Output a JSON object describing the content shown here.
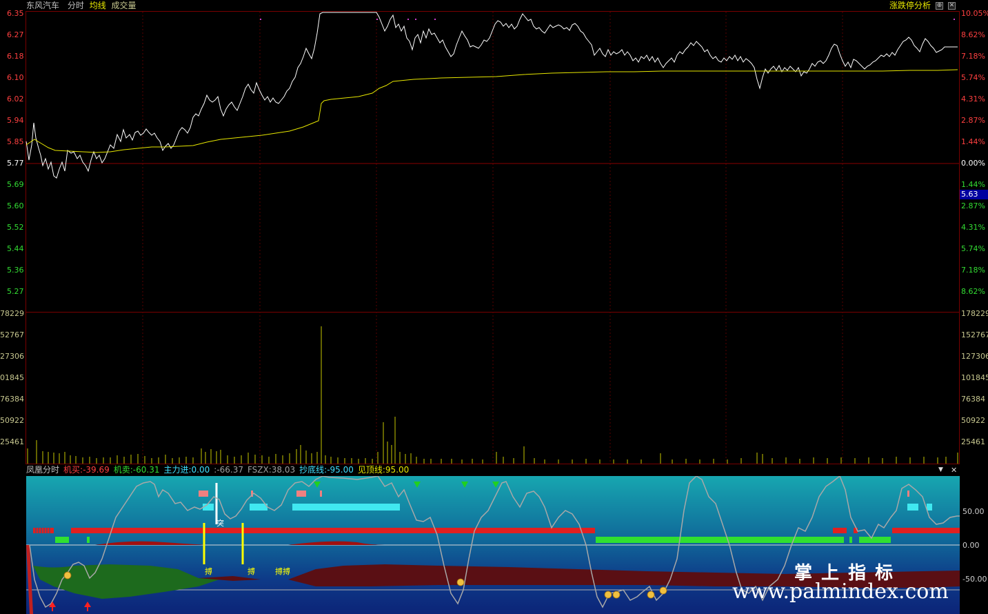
{
  "header": {
    "stock_name": "东风汽车",
    "tab_time": "分时",
    "tab_avg": "均线",
    "tab_volume": "成交量",
    "right_link": "涨跌停分析"
  },
  "price_axis": {
    "left": [
      "6.35",
      "6.27",
      "6.18",
      "6.10",
      "6.02",
      "5.94",
      "5.85",
      "5.77",
      "5.69",
      "5.60",
      "5.52",
      "5.44",
      "5.36",
      "5.27"
    ],
    "right": [
      "10.05%",
      "8.62%",
      "7.18%",
      "5.74%",
      "4.31%",
      "2.87%",
      "1.44%",
      "0.00%",
      "1.44%",
      "2.87%",
      "4.31%",
      "5.74%",
      "7.18%",
      "8.62%"
    ],
    "current_price_tag": "5.63"
  },
  "volume_axis": {
    "left": [
      "78229",
      "52767",
      "27306",
      "01845",
      "76384",
      "50922",
      "25461"
    ],
    "right": [
      "178229",
      "152767",
      "127306",
      "101845",
      "76384",
      "50922",
      "25461"
    ]
  },
  "indicator": {
    "name": "凤凰分时",
    "buy_label": "机买:",
    "buy_value": "-39.69",
    "sell_label": "机卖:",
    "sell_value": "-60.31",
    "main_in_label": "主力进:",
    "main_in_value": "0.00",
    "extra": ":-66.37",
    "fszx_label": "FSZX:",
    "fszx_value": "38.03",
    "bottom_line_label": "抄底线:",
    "bottom_line_value": "-95.00",
    "top_line_label": "见顶线:",
    "top_line_value": "95.00",
    "axis": [
      "50.00",
      "0.00",
      "-50.00"
    ],
    "markers": {
      "bo": "搏",
      "bobo": "搏搏",
      "tu": "突"
    }
  },
  "watermark": {
    "title": "掌 上 指 标",
    "url": "www.palmindex.com"
  },
  "colors": {
    "price_line": "#ffffff",
    "avg_line": "#e8e800",
    "frame": "#7a0000",
    "up": "#ff4040",
    "down": "#33dd33"
  }
}
